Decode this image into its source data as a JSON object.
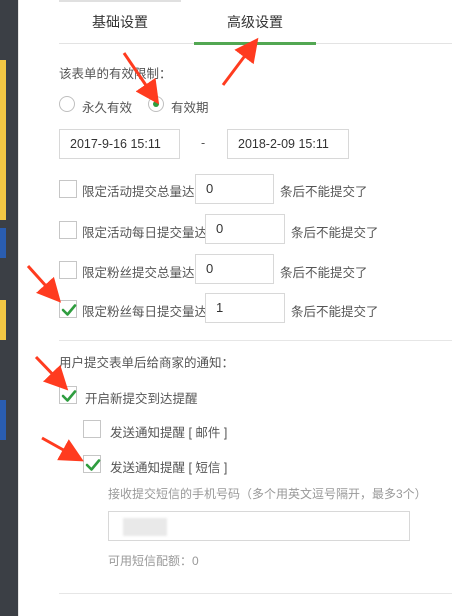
{
  "tabs": [
    {
      "label": "基础设置",
      "active": false
    },
    {
      "label": "高级设置",
      "active": true
    }
  ],
  "validity": {
    "label": "该表单的有效限制：",
    "options": [
      {
        "label": "永久有效",
        "selected": false
      },
      {
        "label": "有效期",
        "selected": true
      }
    ],
    "start": "2017-9-16 15:11",
    "separator": "-",
    "end": "2018-2-09 15:11"
  },
  "limits": [
    {
      "label": "限定活动提交总量达",
      "value": "0",
      "suffix": "条后不能提交了",
      "checked": false
    },
    {
      "label": "限定活动每日提交量达",
      "value": "0",
      "suffix": "条后不能提交了",
      "checked": false
    },
    {
      "label": "限定粉丝提交总量达",
      "value": "0",
      "suffix": "条后不能提交了",
      "checked": false
    },
    {
      "label": "限定粉丝每日提交量达",
      "value": "1",
      "suffix": "条后不能提交了",
      "checked": true
    }
  ],
  "notify": {
    "title": "用户提交表单后给商家的通知：",
    "enable_label": "开启新提交到达提醒",
    "enable_checked": true,
    "email_label": "发送通知提醒 [ 邮件 ]",
    "email_checked": false,
    "sms_label": "发送通知提醒 [ 短信 ]",
    "sms_checked": true,
    "phone_hint": "接收提交短信的手机号码（多个用英文逗号隔开，最多3个）",
    "phone_value": "",
    "quota_label": "可用短信配额：0"
  },
  "colors": {
    "accent": "#52a752",
    "check": "#2f9d3f",
    "arrow": "#ff3b1f",
    "sidebar": "#3b3f45"
  }
}
